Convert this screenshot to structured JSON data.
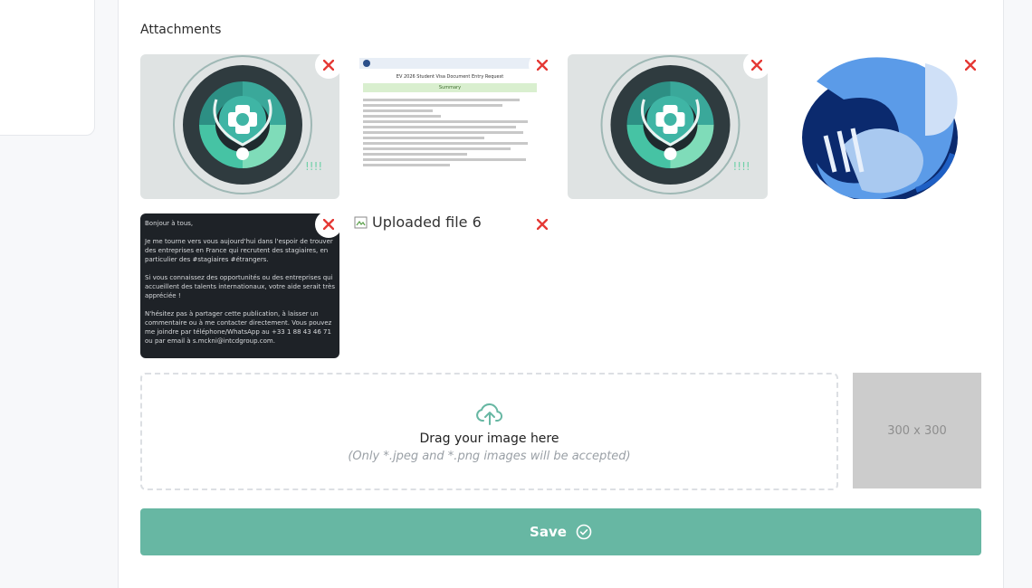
{
  "section": {
    "title": "Attachments"
  },
  "attachments": [
    {
      "kind": "medical-emblem"
    },
    {
      "kind": "document",
      "header": "EV 2026 Student Visa Document Entry Request",
      "banner": "Summary"
    },
    {
      "kind": "medical-emblem"
    },
    {
      "kind": "blue-figures-illustration"
    },
    {
      "kind": "social-post",
      "lines": [
        "Bonjour à tous,",
        "Je me tourne vers vous aujourd'hui dans l'espoir de trouver des entreprises en France qui recrutent des stagiaires, en particulier des #stagiaires #étrangers.",
        "Si vous connaissez des opportunités ou des entreprises qui accueillent des talents internationaux, votre aide serait très appréciée !",
        "N'hésitez pas à partager cette publication, à laisser un commentaire ou à me contacter directement. Vous pouvez me joindre par téléphone/WhatsApp au +33 1 88 43 46 71 ou par email à s.mckni@intcdgroup.com."
      ]
    },
    {
      "kind": "broken",
      "alt": "Uploaded file 6"
    }
  ],
  "dropzone": {
    "title": "Drag your image here",
    "hint": "(Only *.jpeg and *.png images will be accepted)"
  },
  "preview": {
    "label": "300 x 300"
  },
  "save": {
    "label": "Save"
  },
  "colors": {
    "accent": "#67b7a3",
    "remove": "#e53935"
  }
}
